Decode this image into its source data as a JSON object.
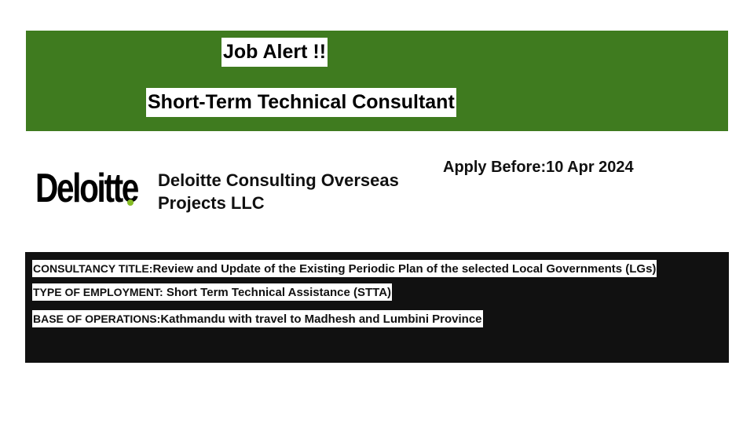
{
  "banner": {
    "headline": "Job Alert !!",
    "title": "Short-Term Technical Consultant",
    "color": "#3f7b1f"
  },
  "employer": {
    "logo_text": "Deloitte",
    "logo_dot_color": "#86bc25",
    "name": "Deloitte Consulting Overseas Projects LLC"
  },
  "deadline": {
    "label": "Apply Before:",
    "date": "10 Apr 2024"
  },
  "details": [
    {
      "label": "CONSULTANCY TITLE:",
      "value": "Review and Update of the Existing Periodic Plan of the selected Local Governments (LGs)"
    },
    {
      "label": "TYPE OF EMPLOYMENT:",
      "value": " Short Term Technical Assistance (STTA)"
    },
    {
      "label": "BASE OF OPERATIONS:",
      "value": "Kathmandu with travel to Madhesh and Lumbini Province"
    }
  ]
}
